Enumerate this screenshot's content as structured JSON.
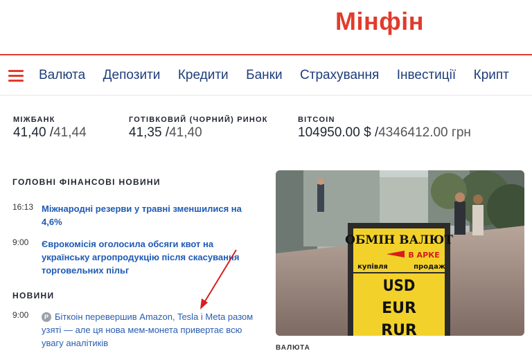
{
  "header": {
    "logo": "Мінфін"
  },
  "nav": {
    "items": [
      {
        "label": "Валюта"
      },
      {
        "label": "Депозити"
      },
      {
        "label": "Кредити"
      },
      {
        "label": "Банки"
      },
      {
        "label": "Страхування"
      },
      {
        "label": "Інвестиції"
      },
      {
        "label": "Крипт"
      }
    ]
  },
  "rates": {
    "interbank": {
      "label": "МІЖБАНК",
      "buy": "41,40",
      "sep": "/",
      "sell": "41,44"
    },
    "cash": {
      "label": "ГОТІВКОВИЙ (ЧОРНИЙ) РИНОК",
      "buy": "41,35",
      "sep": "/",
      "sell": "41,40"
    },
    "bitcoin": {
      "label": "BITCOIN",
      "buy": "104950.00 $",
      "sep": "/",
      "sell": "4346412.00 грн"
    }
  },
  "main_news": {
    "title": "ГОЛОВНІ ФІНАНСОВІ НОВИНИ",
    "items": [
      {
        "time": "16:13",
        "text": "Міжнародні резерви у травні зменшилися на 4,6%"
      },
      {
        "time": "9:00",
        "text": "Єврокомісія оголосила обсяги квот на українську агропродукцію після скасування торговельних пільг"
      }
    ]
  },
  "news": {
    "title": "НОВИНИ",
    "items": [
      {
        "time": "9:00",
        "badge": "P",
        "text": "Біткоін перевершив Amazon, Tesla і Meta разом узяті — але ця нова мем-монета привертає всю увагу аналітиків"
      }
    ]
  },
  "photo": {
    "sign_title": "ОБМІН ВАЛЮТ",
    "sign_arrow": "В АРКЕ",
    "sign_buy": "купівля",
    "sign_sell": "продаж",
    "currencies": [
      "USD",
      "EUR",
      "RUR"
    ],
    "caption": "ВАЛЮТА"
  },
  "colors": {
    "brand": "#e23b2c",
    "nav_text": "#1e3d7a",
    "link": "#1e5ab4"
  }
}
